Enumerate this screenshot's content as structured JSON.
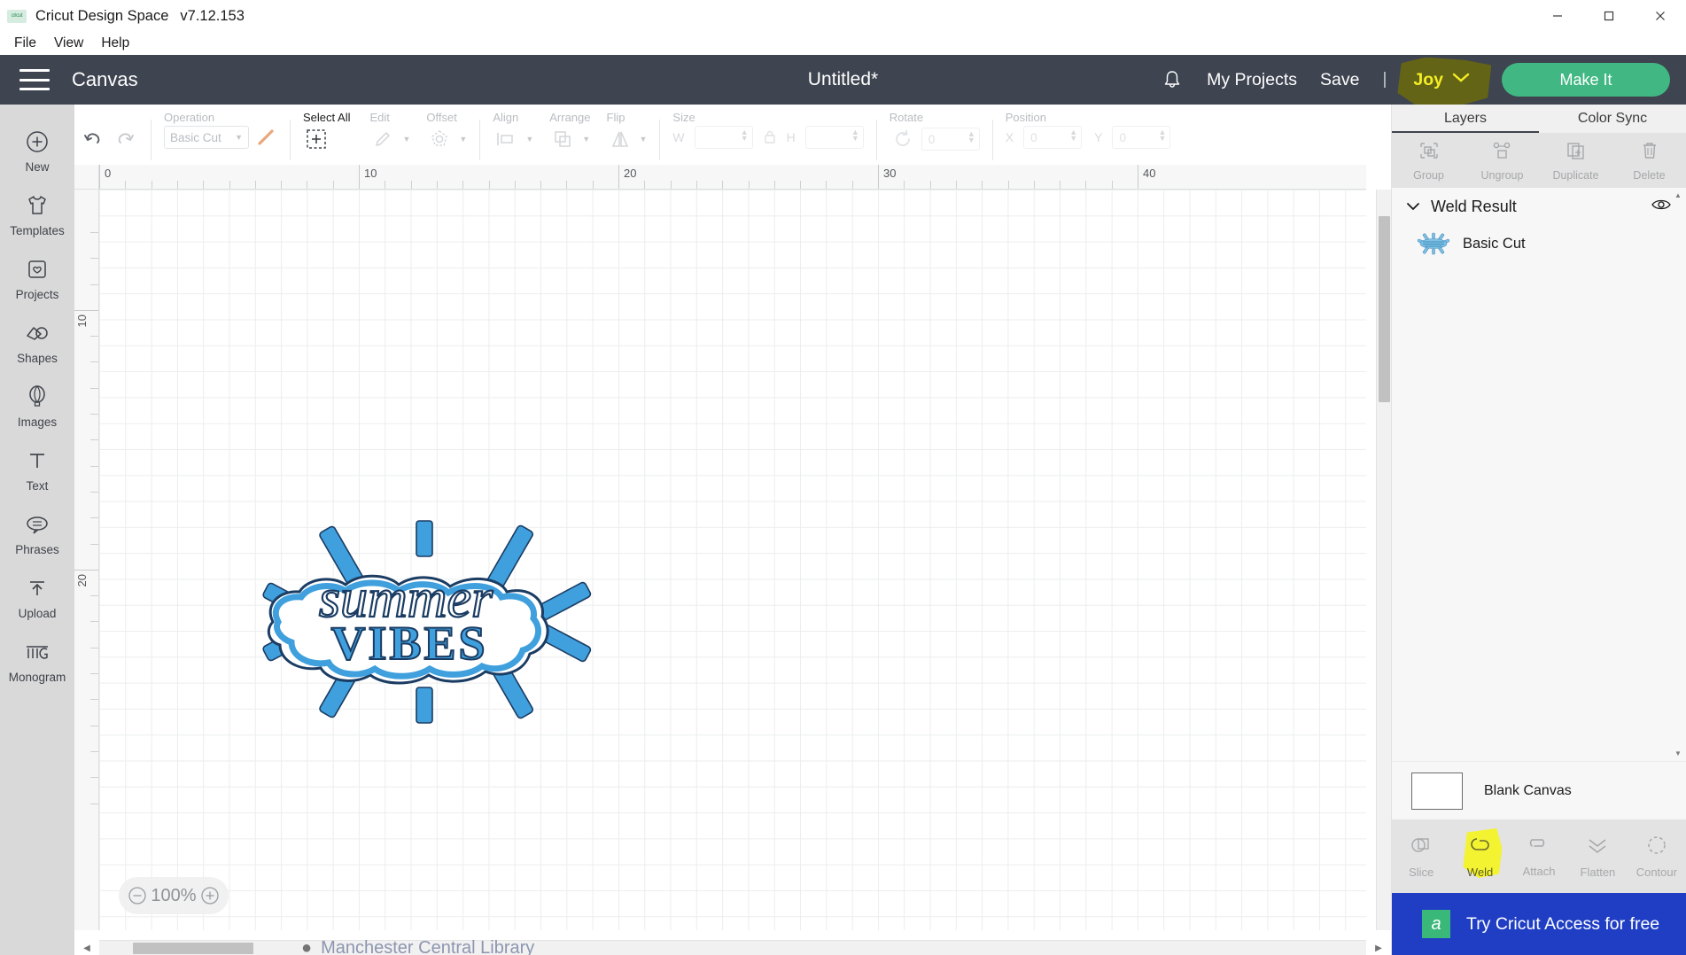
{
  "window": {
    "app_logo": "cricut-logo-icon",
    "title": "Cricut Design Space",
    "version": "v7.12.153",
    "controls": {
      "minimize": "minimize-icon",
      "maximize": "maximize-icon",
      "close": "close-icon"
    }
  },
  "menubar": {
    "items": [
      {
        "label": "File"
      },
      {
        "label": "View"
      },
      {
        "label": "Help"
      }
    ]
  },
  "header": {
    "menu_icon": "hamburger-icon",
    "canvas_label": "Canvas",
    "project_title": "Untitled*",
    "bell_icon": "bell-icon",
    "my_projects": "My Projects",
    "save": "Save",
    "separator": "|",
    "machine": "Joy",
    "machine_chevron": "chevron-down-icon",
    "make_it": "Make It",
    "highlight_color": "#6b6b08",
    "machine_text_color": "#f5ee25",
    "make_it_color": "#41b883"
  },
  "sidebar": {
    "items": [
      {
        "label": "New",
        "icon": "plus-circle-icon"
      },
      {
        "label": "Templates",
        "icon": "tshirt-icon"
      },
      {
        "label": "Projects",
        "icon": "projects-card-icon"
      },
      {
        "label": "Shapes",
        "icon": "shapes-icon"
      },
      {
        "label": "Images",
        "icon": "hot-air-balloon-icon"
      },
      {
        "label": "Text",
        "icon": "text-t-icon"
      },
      {
        "label": "Phrases",
        "icon": "speech-bubble-icon"
      },
      {
        "label": "Upload",
        "icon": "upload-arrow-icon"
      },
      {
        "label": "Monogram",
        "icon": "monogram-mg-icon"
      }
    ]
  },
  "toolbar": {
    "undo": "undo-icon",
    "redo": "redo-icon",
    "operation": {
      "label": "Operation",
      "value": "Basic Cut",
      "swatch_color": "#e8a87c"
    },
    "select_all": {
      "label": "Select All",
      "icon": "select-all-icon"
    },
    "edit": {
      "label": "Edit",
      "icon": "pencil-icon"
    },
    "offset": {
      "label": "Offset",
      "icon": "offset-icon"
    },
    "align": {
      "label": "Align",
      "icon": "align-icon"
    },
    "arrange": {
      "label": "Arrange",
      "icon": "arrange-icon"
    },
    "flip": {
      "label": "Flip",
      "icon": "flip-icon"
    },
    "size": {
      "label": "Size",
      "w_label": "W",
      "w_value": "",
      "h_label": "H",
      "h_value": "",
      "lock_icon": "lock-icon"
    },
    "rotate": {
      "label": "Rotate",
      "icon": "rotate-icon",
      "value": "0"
    },
    "position": {
      "label": "Position",
      "x_label": "X",
      "x_value": "0",
      "y_label": "Y",
      "y_value": "0"
    }
  },
  "canvas": {
    "ruler_h_labels": [
      "0",
      "10",
      "20",
      "30",
      "40"
    ],
    "ruler_v_labels": [
      "10",
      "20"
    ],
    "zoom": {
      "minus": "minus-circle-icon",
      "value": "100%",
      "plus": "plus-circle-icon"
    },
    "artwork": {
      "name": "summer-vibes-artwork",
      "text_script": "summer",
      "text_block": "VIBES",
      "fill_color": "#3fa0dd",
      "stroke_color": "#1b3c63"
    },
    "scrollbar_h": "horizontal-scrollbar",
    "scrollbar_v": "vertical-scrollbar"
  },
  "right_panel": {
    "tabs": [
      {
        "label": "Layers",
        "active": true
      },
      {
        "label": "Color Sync",
        "active": false
      }
    ],
    "actions": [
      {
        "label": "Group",
        "icon": "group-icon"
      },
      {
        "label": "Ungroup",
        "icon": "ungroup-icon"
      },
      {
        "label": "Duplicate",
        "icon": "duplicate-icon"
      },
      {
        "label": "Delete",
        "icon": "trash-icon"
      }
    ],
    "layers": {
      "group_name": "Weld Result",
      "group_chevron": "chevron-down-icon",
      "visibility_icon": "eye-icon",
      "children": [
        {
          "label": "Basic Cut",
          "thumb": "weld-result-thumbnail"
        }
      ]
    },
    "canvas_row": {
      "label": "Blank Canvas",
      "swatch": "#ffffff"
    },
    "tools": [
      {
        "label": "Slice",
        "icon": "slice-icon",
        "highlighted": false
      },
      {
        "label": "Weld",
        "icon": "weld-icon",
        "highlighted": true
      },
      {
        "label": "Attach",
        "icon": "attach-paperclip-icon",
        "highlighted": false
      },
      {
        "label": "Flatten",
        "icon": "flatten-icon",
        "highlighted": false
      },
      {
        "label": "Contour",
        "icon": "contour-icon",
        "highlighted": false
      }
    ],
    "tool_highlight_color": "#f3f327",
    "access_banner": {
      "logo": "cricut-access-logo-icon",
      "text": "Try Cricut Access for free",
      "color": "#1f3ec4"
    }
  },
  "background_bleed": {
    "text": "Manchester Central Library"
  }
}
